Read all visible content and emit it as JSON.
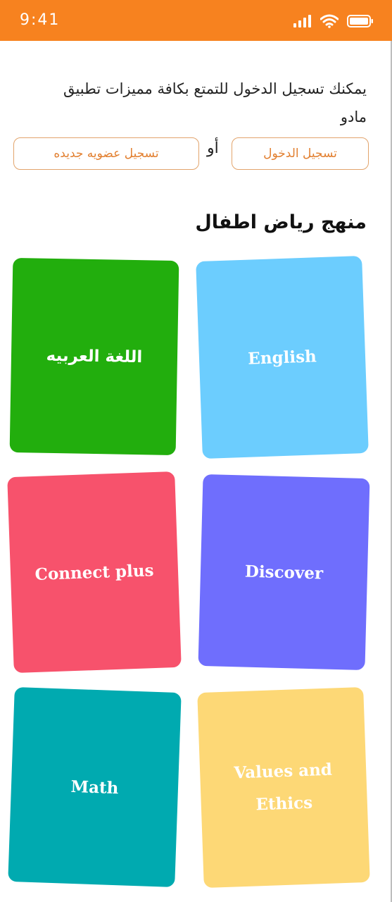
{
  "status_bar": {
    "time": "9:41",
    "color": "#f7821f",
    "icons": [
      "signal-icon",
      "wifi-icon",
      "battery-icon"
    ]
  },
  "intro": {
    "text": "يمكنك تسجيل الدخول للتمتع بكافة مميزات تطبيق مادو"
  },
  "auth": {
    "login_label": "تسجيل الدخول",
    "or_label": "أو",
    "register_label": "تسجيل عضويه جديده",
    "accent": "#e27f2f"
  },
  "section": {
    "title": "منهج رياض اطفال"
  },
  "cards": [
    {
      "label": "اللغة العربيه",
      "color": "#22ae0d"
    },
    {
      "label": "English",
      "color": "#6ccdfe"
    },
    {
      "label": "Connect plus",
      "color": "#f7526c"
    },
    {
      "label": "Discover",
      "color": "#6f6efd"
    },
    {
      "label": "Math",
      "color": "#00aab0"
    },
    {
      "label": "Values and Ethics",
      "color": "#fdd876"
    }
  ]
}
